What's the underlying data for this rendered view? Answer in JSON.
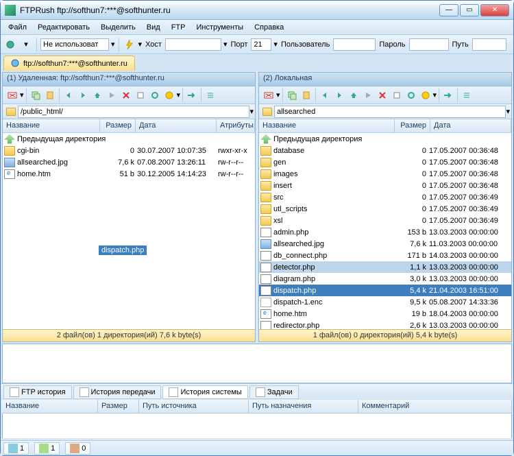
{
  "window": {
    "title": "FTPRush   ftp://softhun7:***@softhunter.ru"
  },
  "menu": [
    "Файл",
    "Редактировать",
    "Выделить",
    "Вид",
    "FTP",
    "Инструменты",
    "Справка"
  ],
  "conn": {
    "profile": "Не использоват",
    "host_label": "Хост",
    "host": "",
    "port_label": "Порт",
    "port": "21",
    "user_label": "Пользователь",
    "user": "",
    "pass_label": "Пароль",
    "pass": "",
    "path_label": "Путь",
    "path": ""
  },
  "session_tab": "ftp://softhun7:***@softhunter.ru",
  "remote": {
    "header": "(1) Удаленная:  ftp://softhun7:***@softhunter.ru",
    "path": "/public_html/",
    "cols": {
      "name": "Название",
      "size": "Размер",
      "date": "Дата",
      "attr": "Атрибуты"
    },
    "parent": "Предыдущая директория",
    "rows": [
      {
        "ic": "fold",
        "name": "cgi-bin",
        "size": "0",
        "date": "30.07.2007 10:07:35",
        "attr": "rwxr-xr-x"
      },
      {
        "ic": "img",
        "name": "allsearched.jpg",
        "size": "7,6 k",
        "date": "07.08.2007 13:26:11",
        "attr": "rw-r--r--"
      },
      {
        "ic": "htm",
        "name": "home.htm",
        "size": "51 b",
        "date": "30.12.2005 14:14:23",
        "attr": "rw-r--r--"
      }
    ],
    "status": "2 файл(ов) 1 директория(ий) 7,6 k byte(s)"
  },
  "local": {
    "header": "(2) Локальная",
    "path": "allsearched",
    "cols": {
      "name": "Название",
      "size": "Размер",
      "date": "Дата"
    },
    "parent": "Предыдущая директория",
    "rows": [
      {
        "ic": "fold",
        "name": "database",
        "size": "0",
        "date": "17.05.2007 00:36:48"
      },
      {
        "ic": "fold",
        "name": "gen",
        "size": "0",
        "date": "17.05.2007 00:36:48"
      },
      {
        "ic": "fold",
        "name": "images",
        "size": "0",
        "date": "17.05.2007 00:36:48"
      },
      {
        "ic": "fold",
        "name": "insert",
        "size": "0",
        "date": "17.05.2007 00:36:48"
      },
      {
        "ic": "fold",
        "name": "src",
        "size": "0",
        "date": "17.05.2007 00:36:49"
      },
      {
        "ic": "fold",
        "name": "utl_scripts",
        "size": "0",
        "date": "17.05.2007 00:36:49"
      },
      {
        "ic": "fold",
        "name": "xsl",
        "size": "0",
        "date": "17.05.2007 00:36:49"
      },
      {
        "ic": "php",
        "name": "admin.php",
        "size": "153 b",
        "date": "13.03.2003 00:00:00"
      },
      {
        "ic": "img",
        "name": "allsearched.jpg",
        "size": "7,6 k",
        "date": "11.03.2003 00:00:00"
      },
      {
        "ic": "php",
        "name": "db_connect.php",
        "size": "171 b",
        "date": "14.03.2003 00:00:00"
      },
      {
        "ic": "php",
        "name": "detector.php",
        "size": "1,1 k",
        "date": "13.03.2003 00:00:00",
        "partsel": true
      },
      {
        "ic": "php",
        "name": "diagram.php",
        "size": "3,0 k",
        "date": "13.03.2003 00:00:00"
      },
      {
        "ic": "php",
        "name": "dispatch.php",
        "size": "5,4 k",
        "date": "21.04.2003 16:51:00",
        "sel": true
      },
      {
        "ic": "file",
        "name": "dispatch-1.enc",
        "size": "9,5 k",
        "date": "05.08.2007 14:33:36"
      },
      {
        "ic": "htm",
        "name": "home.htm",
        "size": "19 b",
        "date": "18.04.2003 00:00:00"
      },
      {
        "ic": "php",
        "name": "redirector.php",
        "size": "2,6 k",
        "date": "13.03.2003 00:00:00"
      }
    ],
    "status": "1 файл(ов) 0 директория(ий) 5,4 k byte(s)"
  },
  "drag_label": "dispatch.php",
  "bottom_tabs": [
    "FTP история",
    "История передачи",
    "История системы",
    "Задачи"
  ],
  "queue_cols": [
    "Название",
    "Размер",
    "Путь источника",
    "Путь назначения",
    "Комментарий"
  ],
  "statusbar": {
    "a": "1",
    "b": "1",
    "c": "0"
  }
}
